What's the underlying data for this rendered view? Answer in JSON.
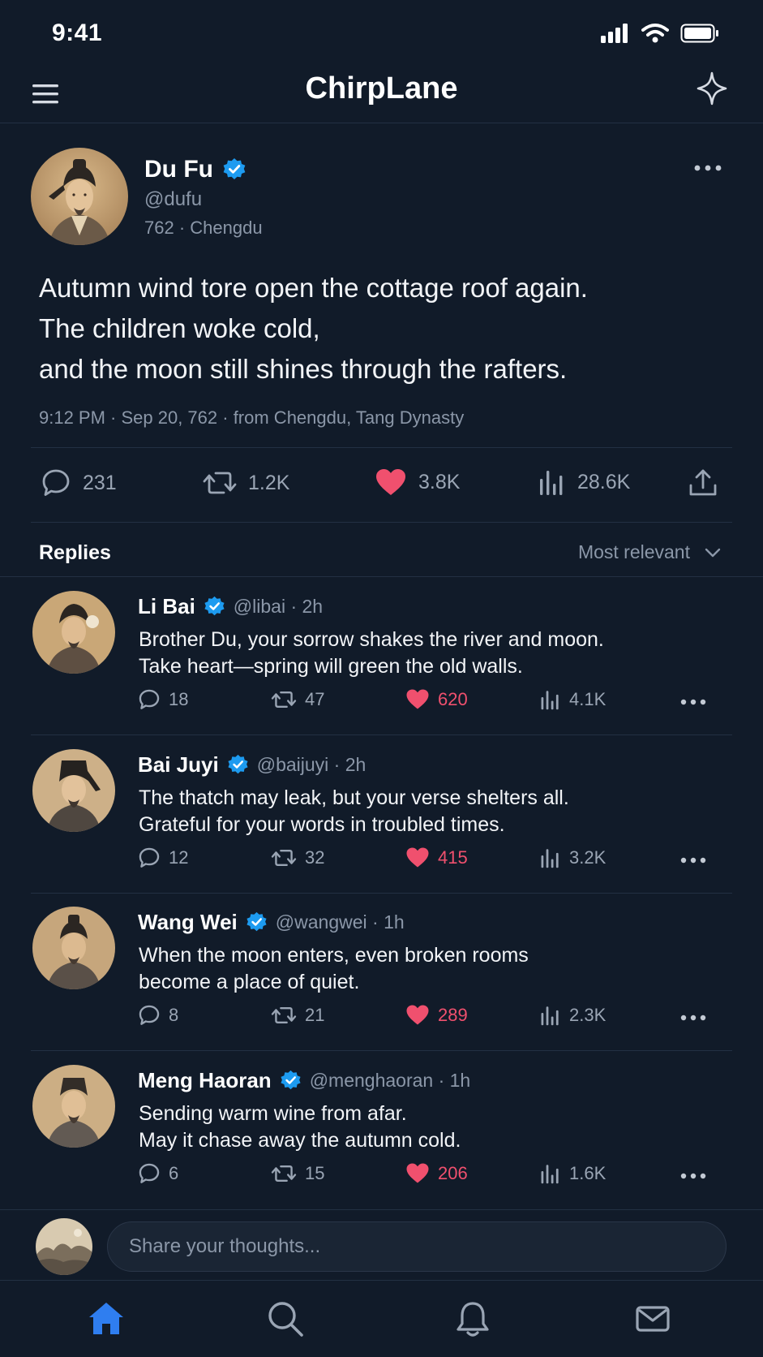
{
  "status_bar": {
    "time": "9:41"
  },
  "app_bar": {
    "title": "ChirpLane"
  },
  "post": {
    "author_name": "Du Fu",
    "author_handle": "@dufu",
    "author_meta": "762 · Chengdu",
    "text_lines": [
      "Autumn wind tore open the cottage roof again.",
      "The children woke cold,",
      "and the moon still shines through the rafters."
    ],
    "timestamp": "9:12 PM · Sep 20, 762 · from Chengdu, Tang Dynasty",
    "stats": {
      "replies": "231",
      "reposts": "1.2K",
      "likes": "3.8K",
      "views": "28.6K"
    }
  },
  "replies_header": {
    "title": "Replies",
    "sort": "Most relevant"
  },
  "replies": [
    {
      "name": "Li Bai",
      "handle": "@libai · 2h",
      "text_lines": [
        "Brother Du, your sorrow shakes the river and moon.",
        "Take heart—spring will green the old walls."
      ],
      "replies": "18",
      "reposts": "47",
      "likes": "620",
      "views": "4.1K"
    },
    {
      "name": "Bai Juyi",
      "handle": "@baijuyi · 2h",
      "text_lines": [
        "The thatch may leak, but your verse shelters all.",
        "Grateful for your words in troubled times."
      ],
      "replies": "12",
      "reposts": "32",
      "likes": "415",
      "views": "3.2K"
    },
    {
      "name": "Wang Wei",
      "handle": "@wangwei · 1h",
      "text_lines": [
        "When the moon enters, even broken rooms",
        "become a place of quiet."
      ],
      "replies": "8",
      "reposts": "21",
      "likes": "289",
      "views": "2.3K"
    },
    {
      "name": "Meng Haoran",
      "handle": "@menghaoran · 1h",
      "text_lines": [
        "Sending warm wine from afar.",
        "May it chase away the autumn cold."
      ],
      "replies": "6",
      "reposts": "15",
      "likes": "206",
      "views": "1.6K"
    }
  ],
  "composer": {
    "placeholder": "Share your thoughts..."
  },
  "tab_bar": {
    "active": "home"
  },
  "colors": {
    "background": "#111b29",
    "accent": "#1d9bf0",
    "like": "#f0506e",
    "muted_text": "#8b97a8",
    "divider": "#233043"
  },
  "icons": [
    "menu-icon",
    "sparkle-icon",
    "verified-icon",
    "more-icon",
    "reply-icon",
    "repost-icon",
    "heart-icon",
    "views-icon",
    "share-icon",
    "chevron-down-icon",
    "home-icon",
    "search-icon",
    "bell-icon",
    "mail-icon"
  ]
}
